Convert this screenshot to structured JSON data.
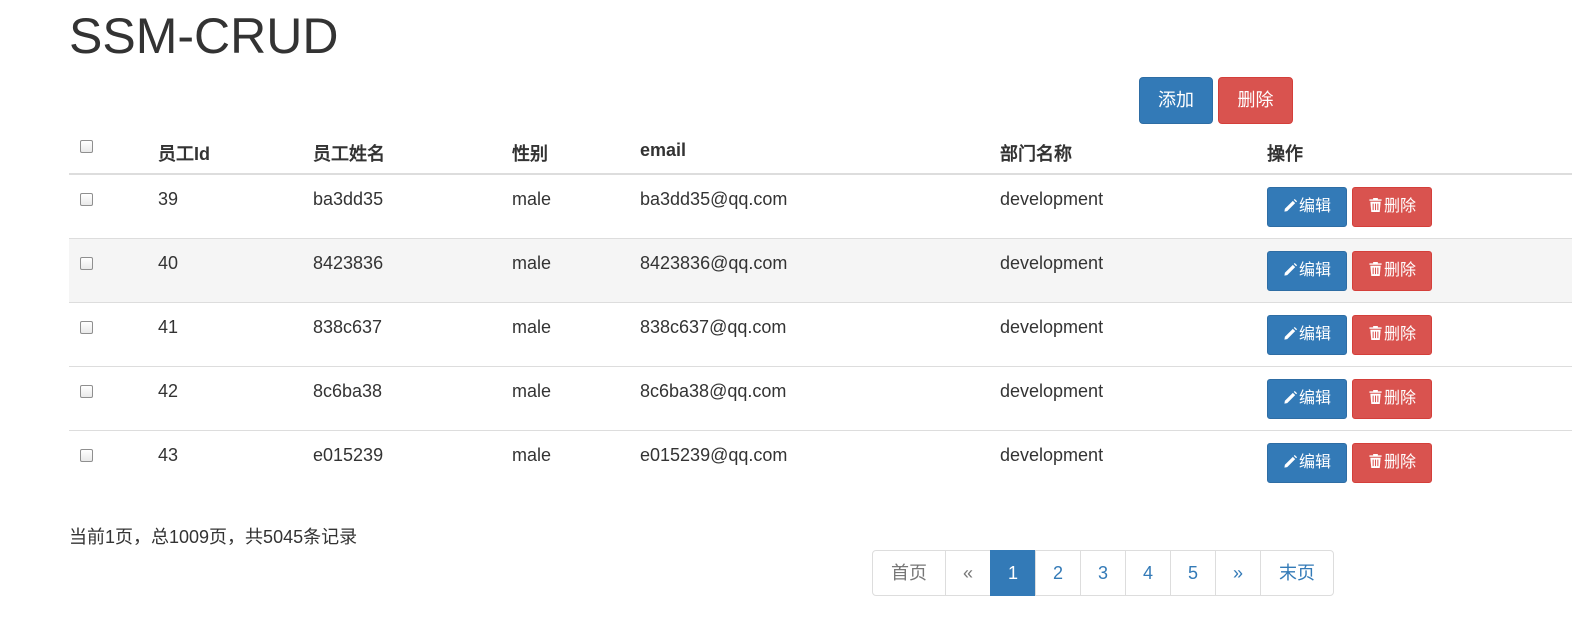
{
  "header": {
    "title": "SSM-CRUD"
  },
  "toolbar": {
    "add_label": "添加",
    "delete_label": "删除"
  },
  "table": {
    "columns": {
      "id": "员工Id",
      "name": "员工姓名",
      "gender": "性别",
      "email": "email",
      "dept": "部门名称",
      "ops": "操作"
    },
    "rows": [
      {
        "id": "39",
        "name": "ba3dd35",
        "gender": "male",
        "email": "ba3dd35@qq.com",
        "dept": "development"
      },
      {
        "id": "40",
        "name": "8423836",
        "gender": "male",
        "email": "8423836@qq.com",
        "dept": "development"
      },
      {
        "id": "41",
        "name": "838c637",
        "gender": "male",
        "email": "838c637@qq.com",
        "dept": "development"
      },
      {
        "id": "42",
        "name": "8c6ba38",
        "gender": "male",
        "email": "8c6ba38@qq.com",
        "dept": "development"
      },
      {
        "id": "43",
        "name": "e015239",
        "gender": "male",
        "email": "e015239@qq.com",
        "dept": "development"
      }
    ],
    "edit_label": "编辑",
    "delete_label": "删除"
  },
  "pager": {
    "info": "当前1页，总1009页，共5045条记录",
    "first": "首页",
    "prev": "«",
    "pages": [
      "1",
      "2",
      "3",
      "4",
      "5"
    ],
    "current": "1",
    "next": "»",
    "last": "末页"
  },
  "icons": {
    "edit": "pencil-icon",
    "delete": "trash-icon"
  },
  "colors": {
    "primary": "#337ab7",
    "danger": "#d9534f",
    "stripe": "#f5f5f5"
  }
}
